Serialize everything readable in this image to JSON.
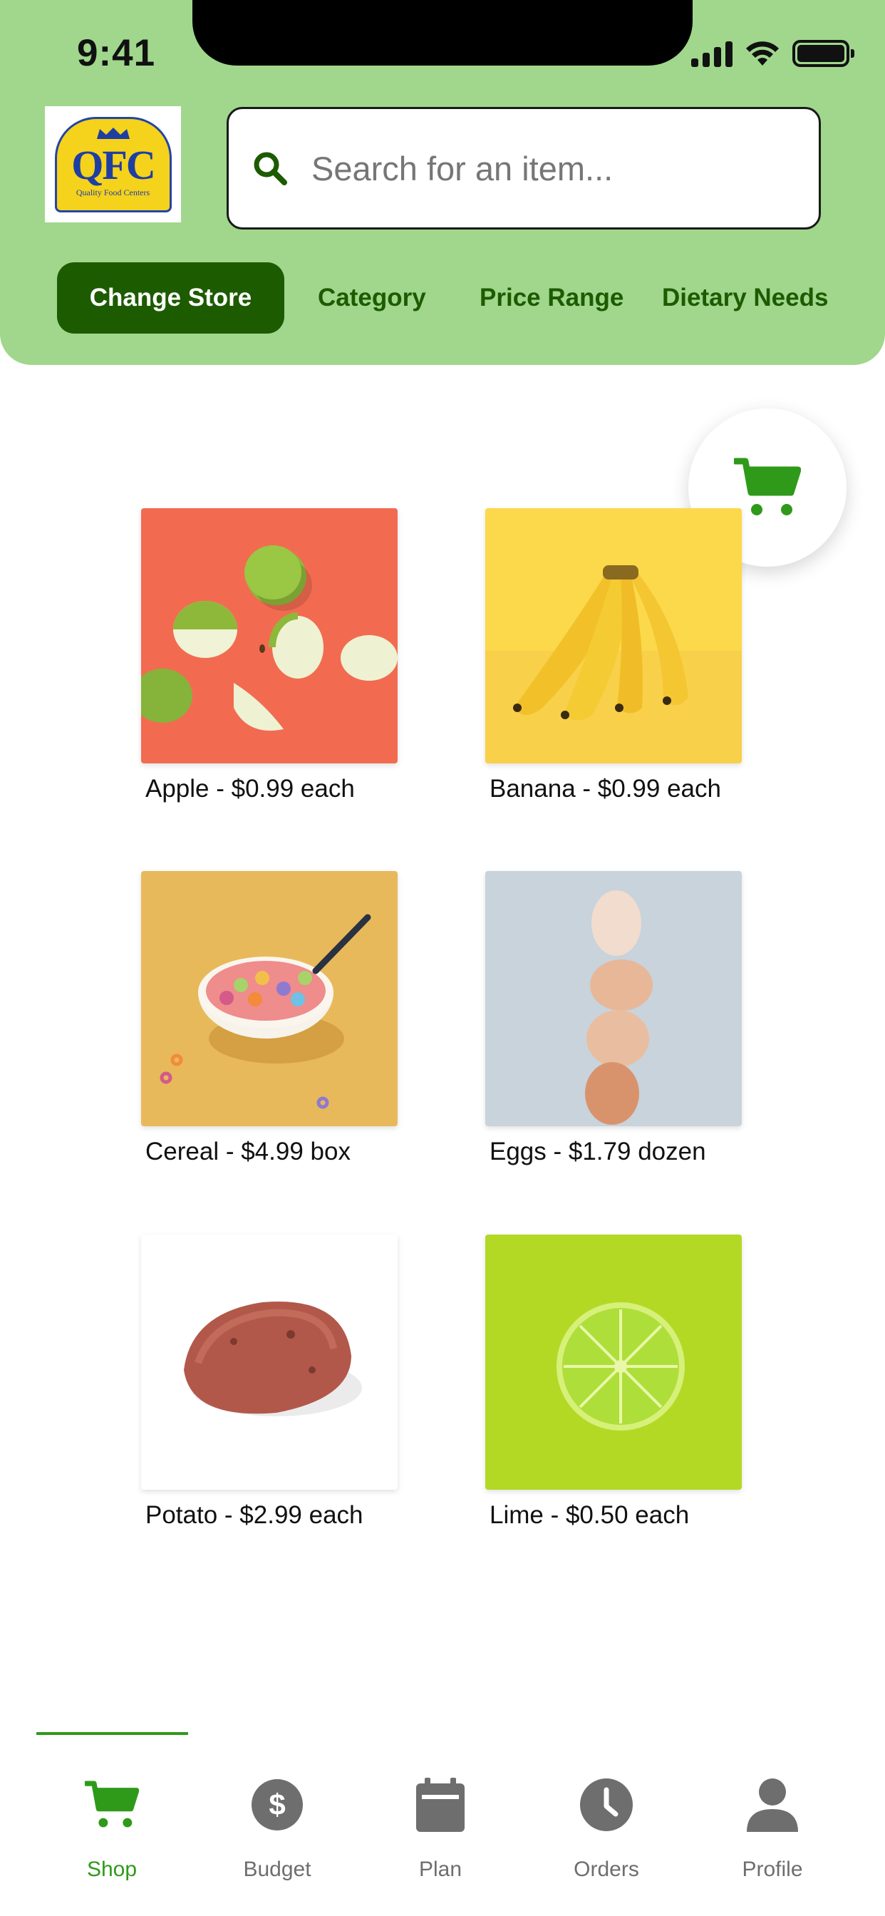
{
  "status_bar": {
    "time": "9:41"
  },
  "header": {
    "logo": {
      "text": "QFC",
      "subtitle": "Quality Food Centers"
    },
    "search": {
      "placeholder": "Search for an item..."
    },
    "filters": [
      {
        "label": "Change Store",
        "active": true
      },
      {
        "label": "Category",
        "active": false
      },
      {
        "label": "Price Range",
        "active": false
      },
      {
        "label": "Dietary Needs",
        "active": false
      }
    ]
  },
  "cart_button": {
    "icon": "cart-icon"
  },
  "products": [
    {
      "label": "Apple - $0.99 each",
      "image": "green apples on coral background"
    },
    {
      "label": "Banana - $0.99 each",
      "image": "banana bunch on yellow background"
    },
    {
      "label": "Cereal - $4.99 box",
      "image": "bowl of fruit rings cereal"
    },
    {
      "label": "Eggs - $1.79 dozen",
      "image": "stack of brown eggs"
    },
    {
      "label": "Potato - $2.99 each",
      "image": "red potato on white"
    },
    {
      "label": "Lime - $0.50 each",
      "image": "lime slice on green"
    }
  ],
  "bottom_nav": [
    {
      "label": "Shop",
      "icon": "cart-icon",
      "active": true
    },
    {
      "label": "Budget",
      "icon": "dollar-icon",
      "active": false
    },
    {
      "label": "Plan",
      "icon": "calendar-icon",
      "active": false
    },
    {
      "label": "Orders",
      "icon": "clock-icon",
      "active": false
    },
    {
      "label": "Profile",
      "icon": "person-icon",
      "active": false
    }
  ],
  "colors": {
    "header_bg": "#a0d78c",
    "primary_dark": "#1d5b00",
    "accent_green": "#2f9a1a",
    "nav_inactive": "#6e6e6e"
  }
}
